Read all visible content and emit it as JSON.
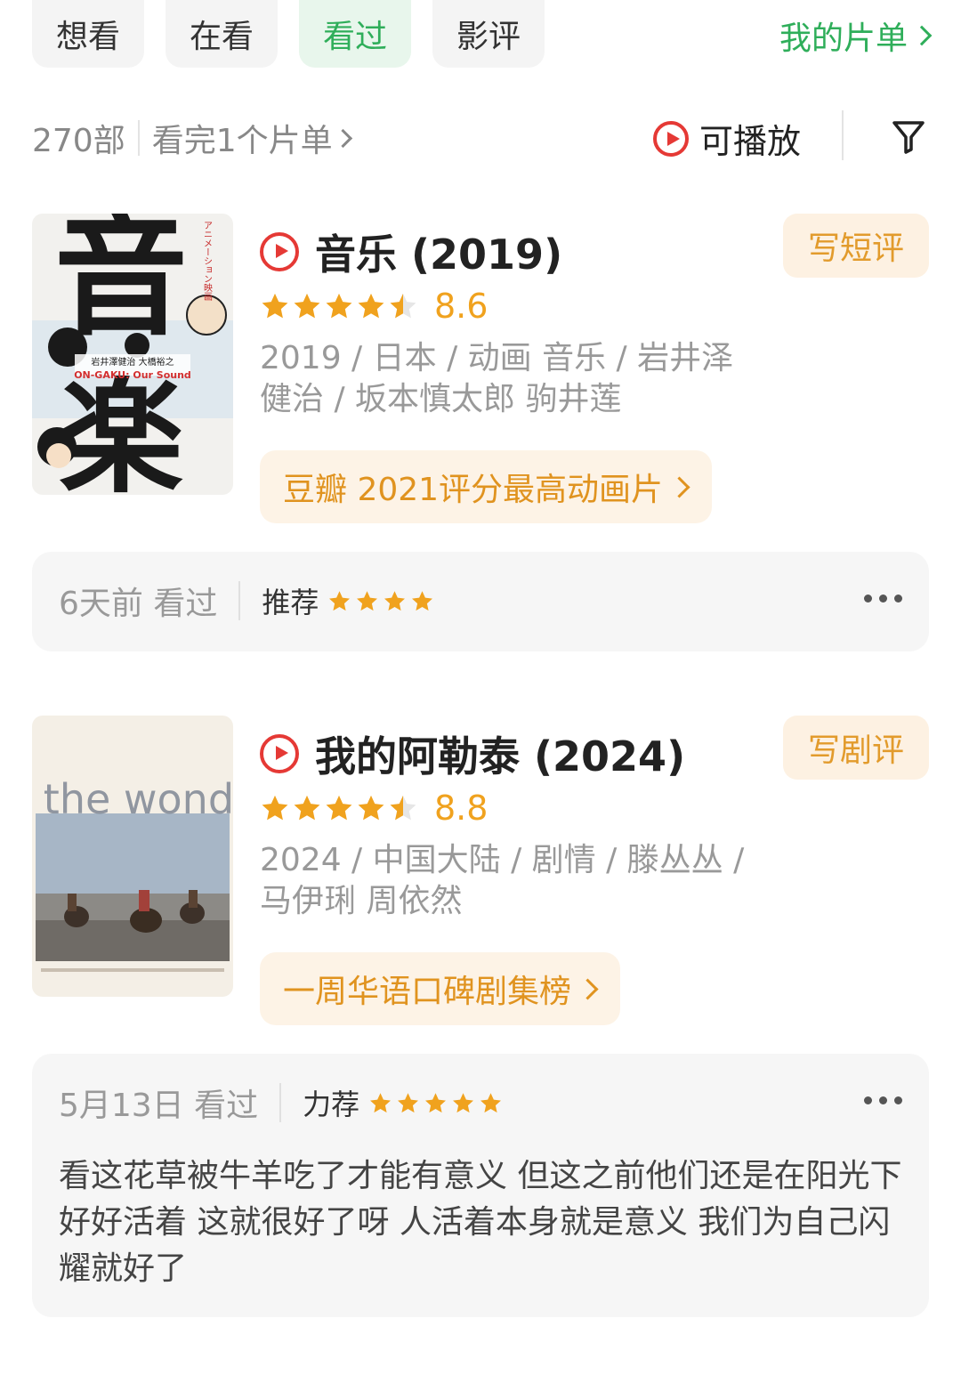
{
  "tabs": [
    {
      "label": "想看",
      "active": false
    },
    {
      "label": "在看",
      "active": false
    },
    {
      "label": "看过",
      "active": true
    },
    {
      "label": "影评",
      "active": false
    }
  ],
  "my_lists": "我的片单",
  "summary": {
    "count": "270部",
    "finished": "看完1个片单",
    "playable": "可播放"
  },
  "movies": [
    {
      "title": "音乐 (2019)",
      "write_label": "写短评",
      "stars": 4.5,
      "score": "8.6",
      "meta": "2019 / 日本 / 动画 音乐 / 岩井泽健治 / 坂本慎太郎 驹井莲",
      "badge": "豆瓣 2021评分最高动画片",
      "poster": {
        "big_text": "音楽",
        "side_text": "アニメーション映画",
        "credit1": "岩井澤健治",
        "credit2": "大橋裕之",
        "en": "ON-GAKU: Our Sound"
      },
      "review": {
        "date": "6天前  看过",
        "level": "推荐",
        "level_stars": 4,
        "text": ""
      }
    },
    {
      "title": "我的阿勒泰 (2024)",
      "write_label": "写剧评",
      "stars": 4.5,
      "score": "8.8",
      "meta": "2024 / 中国大陆 / 剧情 / 滕丛丛 / 马伊琍 周依然",
      "badge": "一周华语口碑剧集榜",
      "poster": {
        "title_en": "To the wonder"
      },
      "review": {
        "date": "5月13日  看过",
        "level": "力荐",
        "level_stars": 5,
        "text": "看这花草被牛羊吃了才能有意义 但这之前他们还是在阳光下好好活着 这就很好了呀 人活着本身就是意义 我们为自己闪耀就好了"
      }
    }
  ],
  "colors": {
    "green": "#2fae5a",
    "orange": "#f0a21e",
    "red": "#e53935"
  }
}
